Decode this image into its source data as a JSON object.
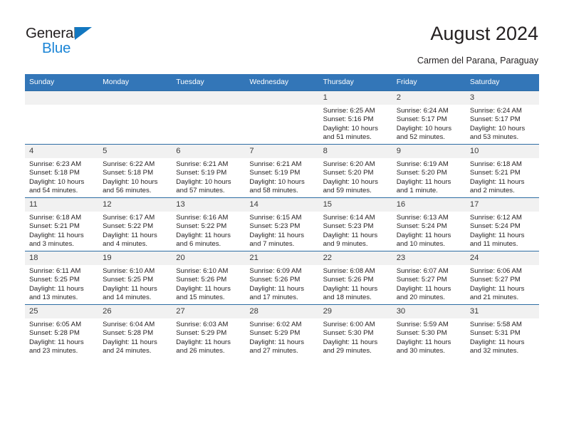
{
  "brand": {
    "name_part1": "General",
    "name_part2": "Blue",
    "accent_color": "#1b85d6",
    "triangle_color": "#1277c0"
  },
  "header": {
    "title": "August 2024",
    "subtitle": "Carmen del Parana, Paraguay",
    "header_bg_color": "#3376b8",
    "daynum_bg_color": "#f1f1f1"
  },
  "weekday_headers": [
    "Sunday",
    "Monday",
    "Tuesday",
    "Wednesday",
    "Thursday",
    "Friday",
    "Saturday"
  ],
  "labels": {
    "sunrise_prefix": "Sunrise:",
    "sunset_prefix": "Sunset:",
    "daylight_prefix": "Daylight:"
  },
  "weeks": [
    [
      {
        "day": "",
        "empty": true,
        "line1": "",
        "line2": "",
        "line3": "",
        "line4": ""
      },
      {
        "day": "",
        "empty": true,
        "line1": "",
        "line2": "",
        "line3": "",
        "line4": ""
      },
      {
        "day": "",
        "empty": true,
        "line1": "",
        "line2": "",
        "line3": "",
        "line4": ""
      },
      {
        "day": "",
        "empty": true,
        "line1": "",
        "line2": "",
        "line3": "",
        "line4": ""
      },
      {
        "day": "1",
        "empty": false,
        "line1": "Sunrise: 6:25 AM",
        "line2": "Sunset: 5:16 PM",
        "line3": "Daylight: 10 hours",
        "line4": "and 51 minutes."
      },
      {
        "day": "2",
        "empty": false,
        "line1": "Sunrise: 6:24 AM",
        "line2": "Sunset: 5:17 PM",
        "line3": "Daylight: 10 hours",
        "line4": "and 52 minutes."
      },
      {
        "day": "3",
        "empty": false,
        "line1": "Sunrise: 6:24 AM",
        "line2": "Sunset: 5:17 PM",
        "line3": "Daylight: 10 hours",
        "line4": "and 53 minutes."
      }
    ],
    [
      {
        "day": "4",
        "empty": false,
        "line1": "Sunrise: 6:23 AM",
        "line2": "Sunset: 5:18 PM",
        "line3": "Daylight: 10 hours",
        "line4": "and 54 minutes."
      },
      {
        "day": "5",
        "empty": false,
        "line1": "Sunrise: 6:22 AM",
        "line2": "Sunset: 5:18 PM",
        "line3": "Daylight: 10 hours",
        "line4": "and 56 minutes."
      },
      {
        "day": "6",
        "empty": false,
        "line1": "Sunrise: 6:21 AM",
        "line2": "Sunset: 5:19 PM",
        "line3": "Daylight: 10 hours",
        "line4": "and 57 minutes."
      },
      {
        "day": "7",
        "empty": false,
        "line1": "Sunrise: 6:21 AM",
        "line2": "Sunset: 5:19 PM",
        "line3": "Daylight: 10 hours",
        "line4": "and 58 minutes."
      },
      {
        "day": "8",
        "empty": false,
        "line1": "Sunrise: 6:20 AM",
        "line2": "Sunset: 5:20 PM",
        "line3": "Daylight: 10 hours",
        "line4": "and 59 minutes."
      },
      {
        "day": "9",
        "empty": false,
        "line1": "Sunrise: 6:19 AM",
        "line2": "Sunset: 5:20 PM",
        "line3": "Daylight: 11 hours",
        "line4": "and 1 minute."
      },
      {
        "day": "10",
        "empty": false,
        "line1": "Sunrise: 6:18 AM",
        "line2": "Sunset: 5:21 PM",
        "line3": "Daylight: 11 hours",
        "line4": "and 2 minutes."
      }
    ],
    [
      {
        "day": "11",
        "empty": false,
        "line1": "Sunrise: 6:18 AM",
        "line2": "Sunset: 5:21 PM",
        "line3": "Daylight: 11 hours",
        "line4": "and 3 minutes."
      },
      {
        "day": "12",
        "empty": false,
        "line1": "Sunrise: 6:17 AM",
        "line2": "Sunset: 5:22 PM",
        "line3": "Daylight: 11 hours",
        "line4": "and 4 minutes."
      },
      {
        "day": "13",
        "empty": false,
        "line1": "Sunrise: 6:16 AM",
        "line2": "Sunset: 5:22 PM",
        "line3": "Daylight: 11 hours",
        "line4": "and 6 minutes."
      },
      {
        "day": "14",
        "empty": false,
        "line1": "Sunrise: 6:15 AM",
        "line2": "Sunset: 5:23 PM",
        "line3": "Daylight: 11 hours",
        "line4": "and 7 minutes."
      },
      {
        "day": "15",
        "empty": false,
        "line1": "Sunrise: 6:14 AM",
        "line2": "Sunset: 5:23 PM",
        "line3": "Daylight: 11 hours",
        "line4": "and 9 minutes."
      },
      {
        "day": "16",
        "empty": false,
        "line1": "Sunrise: 6:13 AM",
        "line2": "Sunset: 5:24 PM",
        "line3": "Daylight: 11 hours",
        "line4": "and 10 minutes."
      },
      {
        "day": "17",
        "empty": false,
        "line1": "Sunrise: 6:12 AM",
        "line2": "Sunset: 5:24 PM",
        "line3": "Daylight: 11 hours",
        "line4": "and 11 minutes."
      }
    ],
    [
      {
        "day": "18",
        "empty": false,
        "line1": "Sunrise: 6:11 AM",
        "line2": "Sunset: 5:25 PM",
        "line3": "Daylight: 11 hours",
        "line4": "and 13 minutes."
      },
      {
        "day": "19",
        "empty": false,
        "line1": "Sunrise: 6:10 AM",
        "line2": "Sunset: 5:25 PM",
        "line3": "Daylight: 11 hours",
        "line4": "and 14 minutes."
      },
      {
        "day": "20",
        "empty": false,
        "line1": "Sunrise: 6:10 AM",
        "line2": "Sunset: 5:26 PM",
        "line3": "Daylight: 11 hours",
        "line4": "and 15 minutes."
      },
      {
        "day": "21",
        "empty": false,
        "line1": "Sunrise: 6:09 AM",
        "line2": "Sunset: 5:26 PM",
        "line3": "Daylight: 11 hours",
        "line4": "and 17 minutes."
      },
      {
        "day": "22",
        "empty": false,
        "line1": "Sunrise: 6:08 AM",
        "line2": "Sunset: 5:26 PM",
        "line3": "Daylight: 11 hours",
        "line4": "and 18 minutes."
      },
      {
        "day": "23",
        "empty": false,
        "line1": "Sunrise: 6:07 AM",
        "line2": "Sunset: 5:27 PM",
        "line3": "Daylight: 11 hours",
        "line4": "and 20 minutes."
      },
      {
        "day": "24",
        "empty": false,
        "line1": "Sunrise: 6:06 AM",
        "line2": "Sunset: 5:27 PM",
        "line3": "Daylight: 11 hours",
        "line4": "and 21 minutes."
      }
    ],
    [
      {
        "day": "25",
        "empty": false,
        "line1": "Sunrise: 6:05 AM",
        "line2": "Sunset: 5:28 PM",
        "line3": "Daylight: 11 hours",
        "line4": "and 23 minutes."
      },
      {
        "day": "26",
        "empty": false,
        "line1": "Sunrise: 6:04 AM",
        "line2": "Sunset: 5:28 PM",
        "line3": "Daylight: 11 hours",
        "line4": "and 24 minutes."
      },
      {
        "day": "27",
        "empty": false,
        "line1": "Sunrise: 6:03 AM",
        "line2": "Sunset: 5:29 PM",
        "line3": "Daylight: 11 hours",
        "line4": "and 26 minutes."
      },
      {
        "day": "28",
        "empty": false,
        "line1": "Sunrise: 6:02 AM",
        "line2": "Sunset: 5:29 PM",
        "line3": "Daylight: 11 hours",
        "line4": "and 27 minutes."
      },
      {
        "day": "29",
        "empty": false,
        "line1": "Sunrise: 6:00 AM",
        "line2": "Sunset: 5:30 PM",
        "line3": "Daylight: 11 hours",
        "line4": "and 29 minutes."
      },
      {
        "day": "30",
        "empty": false,
        "line1": "Sunrise: 5:59 AM",
        "line2": "Sunset: 5:30 PM",
        "line3": "Daylight: 11 hours",
        "line4": "and 30 minutes."
      },
      {
        "day": "31",
        "empty": false,
        "line1": "Sunrise: 5:58 AM",
        "line2": "Sunset: 5:31 PM",
        "line3": "Daylight: 11 hours",
        "line4": "and 32 minutes."
      }
    ]
  ]
}
